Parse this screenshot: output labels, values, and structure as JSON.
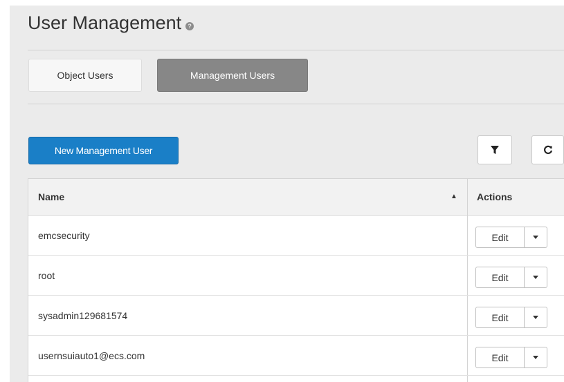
{
  "header": {
    "title": "User Management",
    "help_icon": "question-circle-icon"
  },
  "tabs": [
    {
      "label": "Object Users",
      "active": false
    },
    {
      "label": "Management Users",
      "active": true
    }
  ],
  "toolbar": {
    "new_label": "New Management User",
    "filter_icon": "filter-icon",
    "refresh_icon": "refresh-icon"
  },
  "table": {
    "columns": {
      "name": "Name",
      "actions": "Actions"
    },
    "sort": {
      "column": "Name",
      "direction": "ascending"
    },
    "rows": [
      {
        "name": "emcsecurity",
        "action": "Edit"
      },
      {
        "name": "root",
        "action": "Edit"
      },
      {
        "name": "sysadmin129681574",
        "action": "Edit"
      },
      {
        "name": "usernsuiauto1@ecs.com",
        "action": "Edit"
      }
    ]
  },
  "colors": {
    "primary": "#1a7fc7",
    "active_tab": "#878787",
    "background": "#ebebeb"
  }
}
